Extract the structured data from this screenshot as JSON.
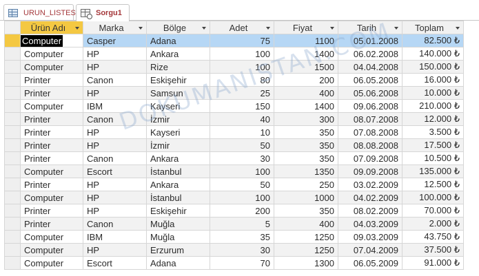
{
  "tabs": [
    {
      "label": "URUN_LISTESI",
      "icon": "table-icon"
    },
    {
      "label": "Sorgu1",
      "icon": "query-icon"
    }
  ],
  "columns": [
    "Ürün Adı",
    "Marka",
    "Bölge",
    "Adet",
    "Fiyat",
    "Tarih",
    "Toplam"
  ],
  "rows": [
    [
      "Computer",
      "Casper",
      "Adana",
      "75",
      "1100",
      "05.01.2008",
      "82.500 ₺"
    ],
    [
      "Computer",
      "HP",
      "Ankara",
      "100",
      "1400",
      "06.02.2008",
      "140.000 ₺"
    ],
    [
      "Computer",
      "HP",
      "Rize",
      "100",
      "1500",
      "04.04.2008",
      "150.000 ₺"
    ],
    [
      "Printer",
      "Canon",
      "Eskişehir",
      "80",
      "200",
      "06.05.2008",
      "16.000 ₺"
    ],
    [
      "Printer",
      "HP",
      "Samsun",
      "25",
      "400",
      "05.06.2008",
      "10.000 ₺"
    ],
    [
      "Computer",
      "IBM",
      "Kayseri",
      "150",
      "1400",
      "09.06.2008",
      "210.000 ₺"
    ],
    [
      "Printer",
      "Canon",
      "İzmir",
      "40",
      "300",
      "08.07.2008",
      "12.000 ₺"
    ],
    [
      "Printer",
      "HP",
      "Kayseri",
      "10",
      "350",
      "07.08.2008",
      "3.500 ₺"
    ],
    [
      "Printer",
      "HP",
      "İzmir",
      "50",
      "350",
      "08.08.2008",
      "17.500 ₺"
    ],
    [
      "Printer",
      "Canon",
      "Ankara",
      "30",
      "350",
      "07.09.2008",
      "10.500 ₺"
    ],
    [
      "Computer",
      "Escort",
      "İstanbul",
      "100",
      "1350",
      "09.09.2008",
      "135.000 ₺"
    ],
    [
      "Printer",
      "HP",
      "Ankara",
      "50",
      "250",
      "03.02.2009",
      "12.500 ₺"
    ],
    [
      "Computer",
      "HP",
      "İstanbul",
      "100",
      "1000",
      "04.02.2009",
      "100.000 ₺"
    ],
    [
      "Printer",
      "HP",
      "Eskişehir",
      "200",
      "350",
      "08.02.2009",
      "70.000 ₺"
    ],
    [
      "Printer",
      "Canon",
      "Muğla",
      "5",
      "400",
      "04.03.2009",
      "2.000 ₺"
    ],
    [
      "Computer",
      "IBM",
      "Muğla",
      "35",
      "1250",
      "09.03.2009",
      "43.750 ₺"
    ],
    [
      "Computer",
      "HP",
      "Erzurum",
      "30",
      "1250",
      "07.04.2009",
      "37.500 ₺"
    ],
    [
      "Computer",
      "Escort",
      "Adana",
      "70",
      "1300",
      "06.05.2009",
      "91.000 ₺"
    ]
  ],
  "watermark": "DOKUMANISTAN.COM",
  "colors": {
    "header_active": "#f4c842",
    "row_selected": "#b6d7f5",
    "tab_text": "#a4373a"
  }
}
